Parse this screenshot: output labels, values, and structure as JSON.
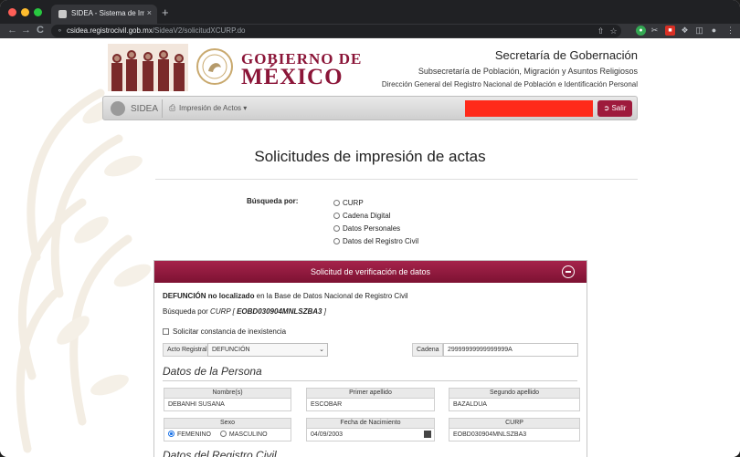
{
  "browser": {
    "tab_title": "SIDEA - Sistema de Impresión",
    "tab_close": "×",
    "new_tab": "+",
    "url_host": "csidea.registrocivil.gob.mx",
    "url_path": "/SideaV2/solicitudXCURP.do",
    "nav_back": "←",
    "nav_forward": "→",
    "nav_reload": "C",
    "icons": [
      "share-icon",
      "star-icon",
      "extension-green-icon",
      "scissors-icon",
      "extension-red-icon",
      "puzzle-icon",
      "sidebar-icon",
      "profile-icon",
      "more-icon"
    ]
  },
  "header": {
    "gob_line1": "GOBIERNO DE",
    "gob_line2": "MÉXICO",
    "secretaria": "Secretaría de Gobernación",
    "subsecretaria": "Subsecretaría de Población, Migración y Asuntos Religiosos",
    "direccion": "Dirección General del Registro Nacional de Población e Identificación Personal"
  },
  "navbar": {
    "brand": "SIDEA",
    "menu_label": "Impresión de Actos",
    "menu_caret": "▾",
    "salir_label": "Salir"
  },
  "main": {
    "title": "Solicitudes de impresión de actas",
    "search_label": "Búsqueda por:",
    "search_options": [
      "CURP",
      "Cadena Digital",
      "Datos Personales",
      "Datos del Registro Civil"
    ]
  },
  "panel": {
    "title": "Solicitud de verificación de datos",
    "msg_bold": "DEFUNCIÓN no localizado",
    "msg_rest": " en la Base de Datos Nacional de Registro Civil",
    "search_prefix": "Búsqueda por ",
    "search_italic": "CURP [ ",
    "search_value": "EOBD030904MNLSZBA3",
    "search_suffix": " ]",
    "constancia_label": "Solicitar constancia de inexistencia",
    "acto_label": "Acto Registral",
    "acto_value": "DEFUNCIÓN",
    "cadena_label": "Cadena",
    "cadena_value": "29999999999999999A",
    "datos_persona_title": "Datos de la Persona",
    "nombre_label": "Nombre(s)",
    "nombre_value": "DEBANHI SUSANA",
    "primer_apellido_label": "Primer apellido",
    "primer_apellido_value": "ESCOBAR",
    "segundo_apellido_label": "Segundo apellido",
    "segundo_apellido_value": "BAZALDUA",
    "sexo_label": "Sexo",
    "sexo_f": "FEMENINO",
    "sexo_m": "MASCULINO",
    "fecha_label": "Fecha de Nacimiento",
    "fecha_value": "04/09/2003",
    "curp_label": "CURP",
    "curp_value": "EOBD030904MNLSZBA3",
    "datos_registro_title": "Datos del Registro Civil"
  },
  "colors": {
    "brand": "#8b1538",
    "panel_header": "#9e1a3c",
    "redaction": "#ff2a1a"
  }
}
